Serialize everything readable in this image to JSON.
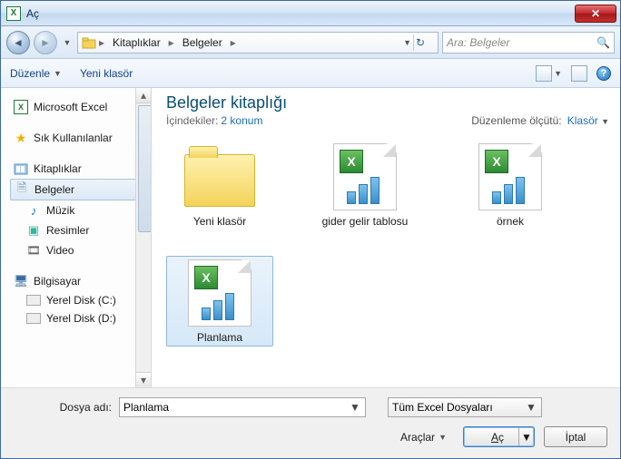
{
  "window": {
    "title": "Aç"
  },
  "nav": {
    "breadcrumb": [
      "Kitaplıklar",
      "Belgeler"
    ],
    "search_placeholder": "Ara: Belgeler"
  },
  "toolbar": {
    "organize": "Düzenle",
    "new_folder": "Yeni klasör"
  },
  "tree": {
    "excel": "Microsoft Excel",
    "favorites": "Sık Kullanılanlar",
    "libraries": "Kitaplıklar",
    "items": {
      "documents": "Belgeler",
      "music": "Müzik",
      "pictures": "Resimler",
      "video": "Video"
    },
    "computer": "Bilgisayar",
    "drives": {
      "c": "Yerel Disk (C:)",
      "d": "Yerel Disk (D:)"
    }
  },
  "library": {
    "title": "Belgeler kitaplığı",
    "includes_label": "İçindekiler:",
    "includes_link": "2 konum",
    "arrange_label": "Düzenleme ölçütü:",
    "arrange_value": "Klasör"
  },
  "files": [
    {
      "name": "Yeni klasör",
      "type": "folder"
    },
    {
      "name": "gider gelir tablosu",
      "type": "excel"
    },
    {
      "name": "örnek",
      "type": "excel"
    },
    {
      "name": "Planlama",
      "type": "excel",
      "selected": true
    }
  ],
  "footer": {
    "filename_label": "Dosya adı:",
    "filename_value": "Planlama",
    "filter_value": "Tüm Excel Dosyaları",
    "tools_label": "Araçlar",
    "open_label": "Aç",
    "cancel_label": "İptal"
  }
}
